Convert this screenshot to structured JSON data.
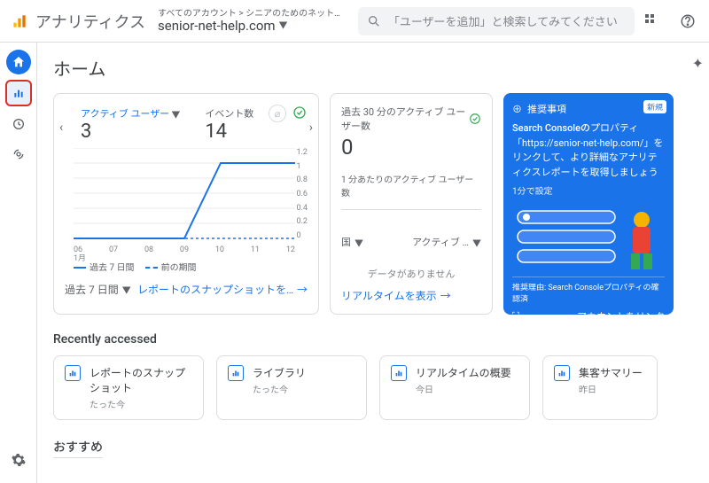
{
  "app_title": "アナリティクス",
  "breadcrumb": "すべてのアカウント > シニアのためのネット…",
  "property": "senior-net-help.com",
  "search_placeholder": "「ユーザーを追加」と検索してみてください",
  "page_title": "ホーム",
  "card1": {
    "metric1_label": "アクティブ ユーザー",
    "metric1_value": "3",
    "metric2_label": "イベント数",
    "metric2_value": "14",
    "legend_current": "過去 7 日間",
    "legend_prev": "前の期間",
    "period_dropdown": "過去 7 日間",
    "footer_link": "レポートのスナップショットを…",
    "xlabel_month": "1月"
  },
  "card2": {
    "title": "過去 30 分のアクティブ ユーザー数",
    "value": "0",
    "sub": "1 分あたりのアクティブ ユーザー数",
    "col1": "国",
    "col2": "アクティブ …",
    "nodata": "データがありません",
    "footer_link": "リアルタイムを表示"
  },
  "card3": {
    "header": "推奨事項",
    "badge": "新規",
    "line1a": "Search Consoleの",
    "line1b": "プロパティ",
    "line2": "「https://senior-net-help.com/」をリンクして、より詳細なアナリティクスレポートを取得しましょう",
    "time": "1分で設定",
    "reason": "推奨理由: Search Consoleプロパティの確認済",
    "action": "アカウントをリンク"
  },
  "recent_title": "Recently accessed",
  "recent": [
    {
      "title": "レポートのスナップショット",
      "sub": "たった今"
    },
    {
      "title": "ライブラリ",
      "sub": "たった今"
    },
    {
      "title": "リアルタイムの概要",
      "sub": "今日"
    },
    {
      "title": "集客サマリー",
      "sub": "昨日"
    }
  ],
  "suggest_title": "おすすめ",
  "chart_data": {
    "type": "line",
    "x": [
      "06",
      "07",
      "08",
      "09",
      "10",
      "11",
      "12"
    ],
    "series": [
      {
        "name": "過去 7 日間",
        "values": [
          0,
          0,
          0,
          0,
          1,
          1,
          1
        ],
        "color": "#1a73e8",
        "dash": false
      },
      {
        "name": "前の期間",
        "values": [
          0,
          0,
          0,
          0,
          0,
          0,
          0
        ],
        "color": "#1a73e8",
        "dash": true
      }
    ],
    "ylim": [
      0,
      1.2
    ],
    "yticks": [
      0,
      0.2,
      0.4,
      0.6,
      0.8,
      1,
      1.2
    ],
    "xlabel": "1月"
  }
}
